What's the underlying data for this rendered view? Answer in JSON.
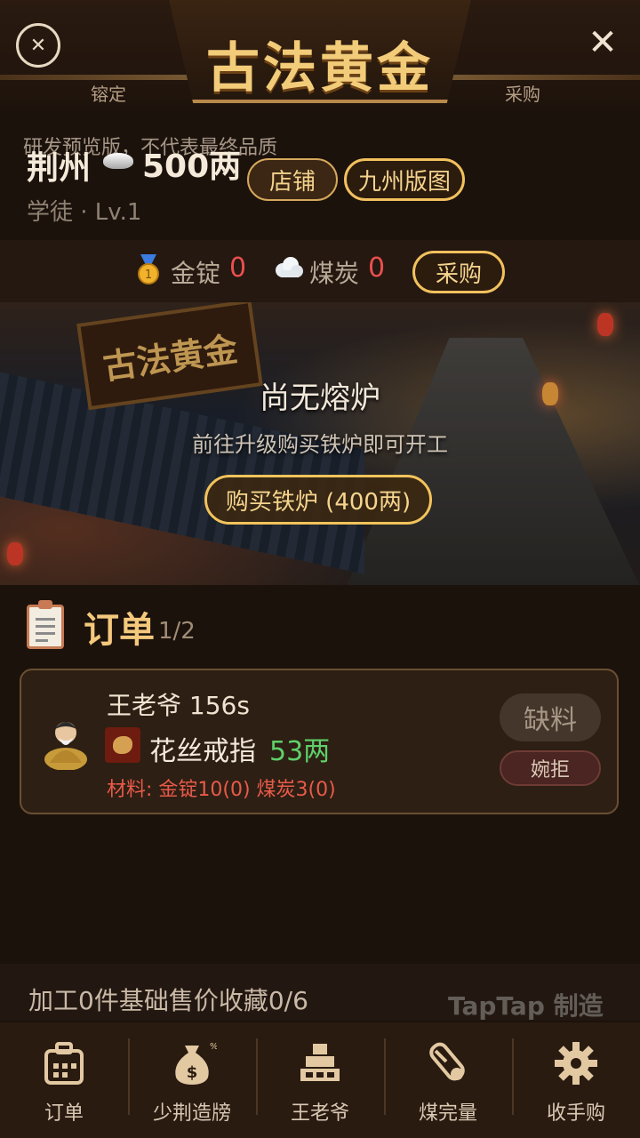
{
  "header": {
    "title": "古法黄金",
    "left_label": "镕定",
    "right_label": "采购",
    "lock_icon": "lock-circle-icon",
    "close_icon": "close-icon"
  },
  "notice": "研发预览版，不代表最终品质",
  "player": {
    "city": "荆州",
    "money": "500两",
    "rank": "学徒 · Lv.1",
    "shop_button": "店铺",
    "map_button": "九州版图"
  },
  "resources": {
    "gold_label": "金锭",
    "gold_value": "0",
    "coal_label": "煤炭",
    "coal_value": "0",
    "buy_button": "采购"
  },
  "scene": {
    "sign_text": "古法黄金",
    "status": "尚无熔炉",
    "hint": "前往升级购买铁炉即可开工",
    "buy_furnace_button": "购买铁炉 (400两)"
  },
  "orders": {
    "title": "订单",
    "count": "1/2",
    "items": [
      {
        "customer": "王老爷 156s",
        "item_name": "花丝戒指",
        "price": "53两",
        "materials": "材料: 金锭10(0) 煤炭3(0)",
        "lack_button": "缺料",
        "reject_button": "婉拒"
      }
    ]
  },
  "stats_line": "加工0件基础售价收藏0/6",
  "watermark": "TapTap 制造",
  "tabs": [
    {
      "label": "订单",
      "icon": "briefcase-icon"
    },
    {
      "label": "少荆造牓",
      "icon": "money-bag-icon"
    },
    {
      "label": "王老爷",
      "icon": "gold-bars-icon"
    },
    {
      "label": "煤完量",
      "icon": "key-tag-icon"
    },
    {
      "label": "收手购",
      "icon": "gear-icon"
    }
  ],
  "colors": {
    "accent_gold": "#f3cc7a",
    "warning_red": "#ea4f4f",
    "price_green": "#5ed06a",
    "background": "#1c120c"
  }
}
